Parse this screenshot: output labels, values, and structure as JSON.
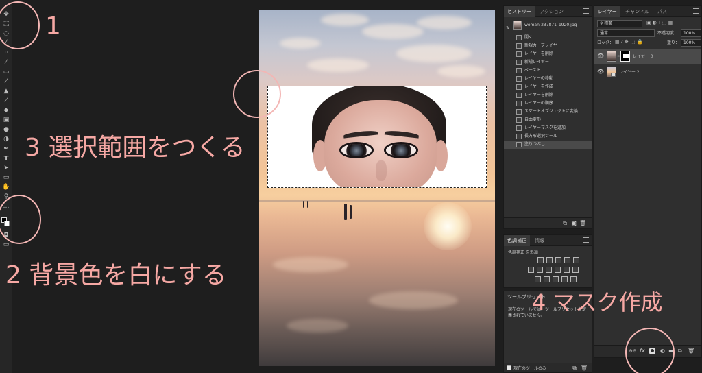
{
  "toolbar": {
    "tools": [
      "move-tool-icon",
      "marquee-tool-icon",
      "lasso-tool-icon",
      "magic-wand-icon",
      "crop-tool-icon",
      "eyedropper-icon",
      "healing-brush-icon",
      "brush-tool-icon",
      "clone-stamp-icon",
      "history-brush-icon",
      "eraser-icon",
      "gradient-tool-icon",
      "blur-tool-icon",
      "dodge-tool-icon",
      "pen-tool-icon",
      "type-tool-icon",
      "path-select-icon",
      "rectangle-tool-icon",
      "hand-tool-icon",
      "zoom-tool-icon",
      "more-tools-icon"
    ],
    "type_glyph": "T"
  },
  "annotations": {
    "a1": "1",
    "a2": "2 背景色を白にする",
    "a3": "3 選択範囲をつくる",
    "a4": "4 マスク作成"
  },
  "history": {
    "tabs": [
      "ヒストリー",
      "アクション"
    ],
    "snapshot": "woman-237871_1920.jpg",
    "items": [
      "開く",
      "新規カーブレイヤー",
      "レイヤーを削除",
      "新規レイヤー",
      "ペースト",
      "レイヤーの移動",
      "レイヤーを作成",
      "レイヤーを削除",
      "レイヤーの順序",
      "スマートオブジェクトに変換",
      "自由変形",
      "レイヤーマスクを追加",
      "長方形選択ツール",
      "塗りつぶし"
    ]
  },
  "adjustments": {
    "tabs": [
      "色調補正",
      "情報"
    ],
    "add_label": "色調補正 を追加"
  },
  "tool_presets": {
    "title": "ツールプリセット",
    "message": "現在のツールでは、ツールプリセットが定義されていません。",
    "checkbox_label": "現在のツールのみ"
  },
  "layers": {
    "tabs": [
      "レイヤー",
      "チャンネル",
      "パス"
    ],
    "filter_label": "種類",
    "blend_mode": "通常",
    "opacity_label": "不透明度：",
    "opacity_value": "100%",
    "lock_label": "ロック：",
    "fill_label": "塗り：",
    "fill_value": "100%",
    "items": [
      {
        "name": "レイヤー 0"
      },
      {
        "name": "レイヤー 2"
      }
    ]
  },
  "colors": {
    "annotation": "#f6a8a4",
    "panel_bg": "#2f2f2f",
    "selected_row": "#4a4a4a"
  }
}
